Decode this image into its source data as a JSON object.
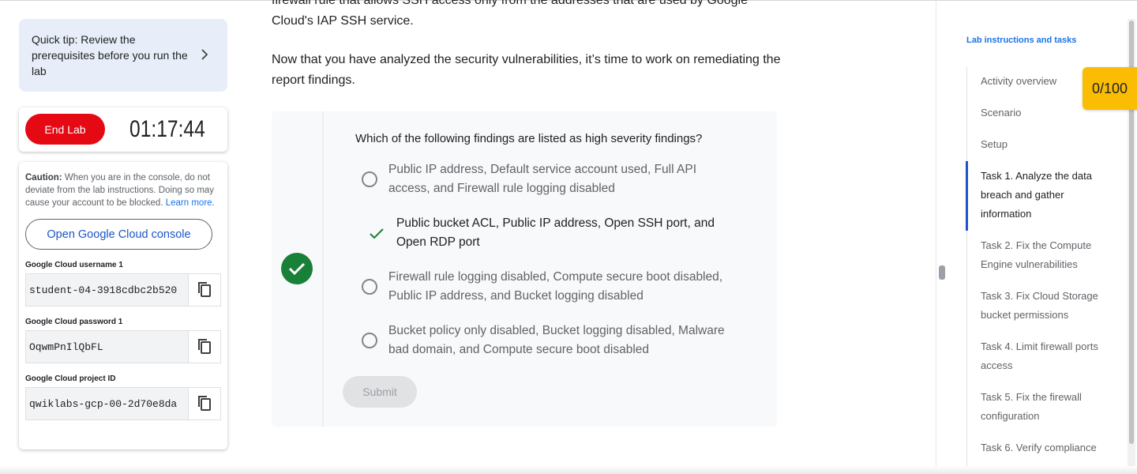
{
  "left": {
    "tip": "Quick tip: Review the prerequisites before you run the lab",
    "end_lab": "End Lab",
    "timer": "01:17:44",
    "caution_bold": "Caution:",
    "caution_text": " When you are in the console, do not deviate from the lab instructions. Doing so may cause your account to be blocked. ",
    "learn_more": "Learn more.",
    "console_button": "Open Google Cloud console",
    "username_label": "Google Cloud username 1",
    "username_value": "student-04-3918cdbc2b520",
    "password_label": "Google Cloud password 1",
    "password_value": "OqwmPnIlQbFL",
    "project_label": "Google Cloud project ID",
    "project_value": "qwiklabs-gcp-00-2d70e8da"
  },
  "main": {
    "para1": "firewall rule that allows SSH access only from the addresses that are used by Google Cloud's IAP SSH service.",
    "para2": "Now that you have analyzed the security vulnerabilities, it’s time to work on remediating the report findings.",
    "question": "Which of the following findings are listed as high severity findings?",
    "options": [
      "Public IP address, Default service account used, Full API access, and Firewall rule logging disabled",
      "Public bucket ACL, Public IP address, Open SSH port, and Open RDP port",
      "Firewall rule logging disabled, Compute secure boot disabled, Public IP address, and Bucket logging disabled",
      "Bucket policy only disabled, Bucket logging disabled, Malware bad domain, and Compute secure boot disabled"
    ],
    "submit": "Submit"
  },
  "right": {
    "heading": "Lab instructions and tasks",
    "score": "0/100",
    "items": [
      "Activity overview",
      "Scenario",
      "Setup",
      "Task 1. Analyze the data breach and gather information",
      "Task 2. Fix the Compute Engine vulnerabilities",
      "Task 3. Fix Cloud Storage bucket permissions",
      "Task 4. Limit firewall ports access",
      "Task 5. Fix the firewall configuration",
      "Task 6. Verify compliance"
    ]
  },
  "colors": {
    "accent": "#1a73e8",
    "end_lab": "#e50914",
    "success": "#188038",
    "score": "#fbbc04"
  }
}
